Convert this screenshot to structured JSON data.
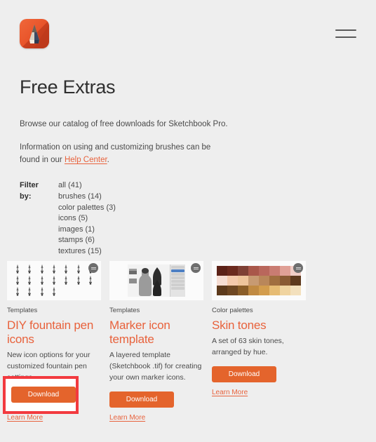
{
  "header": {
    "logo_icon": "sketchbook-pencil-logo",
    "menu_icon": "hamburger-menu-icon"
  },
  "intro": {
    "title": "Free Extras",
    "paragraph_1": "Browse our catalog of free downloads for Sketchbook Pro.",
    "paragraph_2_before": "Information on using and customizing brushes can be found in our ",
    "paragraph_2_link": "Help Center",
    "paragraph_2_after": "."
  },
  "filter": {
    "label": "Filter by:",
    "options": [
      "all (41)",
      "brushes (14)",
      "color palettes (3)",
      "icons (5)",
      "images (1)",
      "stamps (6)",
      "textures (15)"
    ]
  },
  "cards": [
    {
      "category": "Templates",
      "title": "DIY fountain pen icons",
      "description": "New icon options for your customized fountain pen settings.",
      "download_label": "Download",
      "learn_more_label": "Learn More",
      "thumbnail": "fountain-pen-nib-grid",
      "badge_icon": "platform-badge-icon"
    },
    {
      "category": "Templates",
      "title": "Marker icon template",
      "description": "A layered template (Sketchbook .tif) for creating your own marker icons.",
      "download_label": "Download",
      "learn_more_label": "Learn More",
      "thumbnail": "marker-shapes-layers-panel",
      "badge_icon": "platform-badge-icon"
    },
    {
      "category": "Color palettes",
      "title": "Skin tones",
      "description": "A set of 63 skin tones, arranged by hue.",
      "download_label": "Download",
      "learn_more_label": "Learn More",
      "thumbnail": "skin-tone-swatch-grid",
      "badge_icon": "platform-badge-icon"
    }
  ],
  "annotation": {
    "highlight_color": "#f23a3f",
    "highlighted_label": "Download"
  },
  "palette_colors": [
    "#5c2218",
    "#6b2a1e",
    "#7e4035",
    "#a9574a",
    "#b9675c",
    "#c97c72",
    "#e0a096",
    "#f0cdc6",
    "#f6ddd3",
    "#f4c9ab",
    "#eec49b",
    "#c79a72",
    "#b9875a",
    "#a06e3f",
    "#8a5a33",
    "#5e3a1e",
    "#5d3a1c",
    "#6e4722",
    "#8a5d28",
    "#c08a42",
    "#d39d4d",
    "#e6bc74",
    "#f0d4a0",
    "#f3e0bd"
  ],
  "theme": {
    "background": "#eeeeee",
    "accent_orange": "#e8623c",
    "button_orange": "#e4642c"
  }
}
